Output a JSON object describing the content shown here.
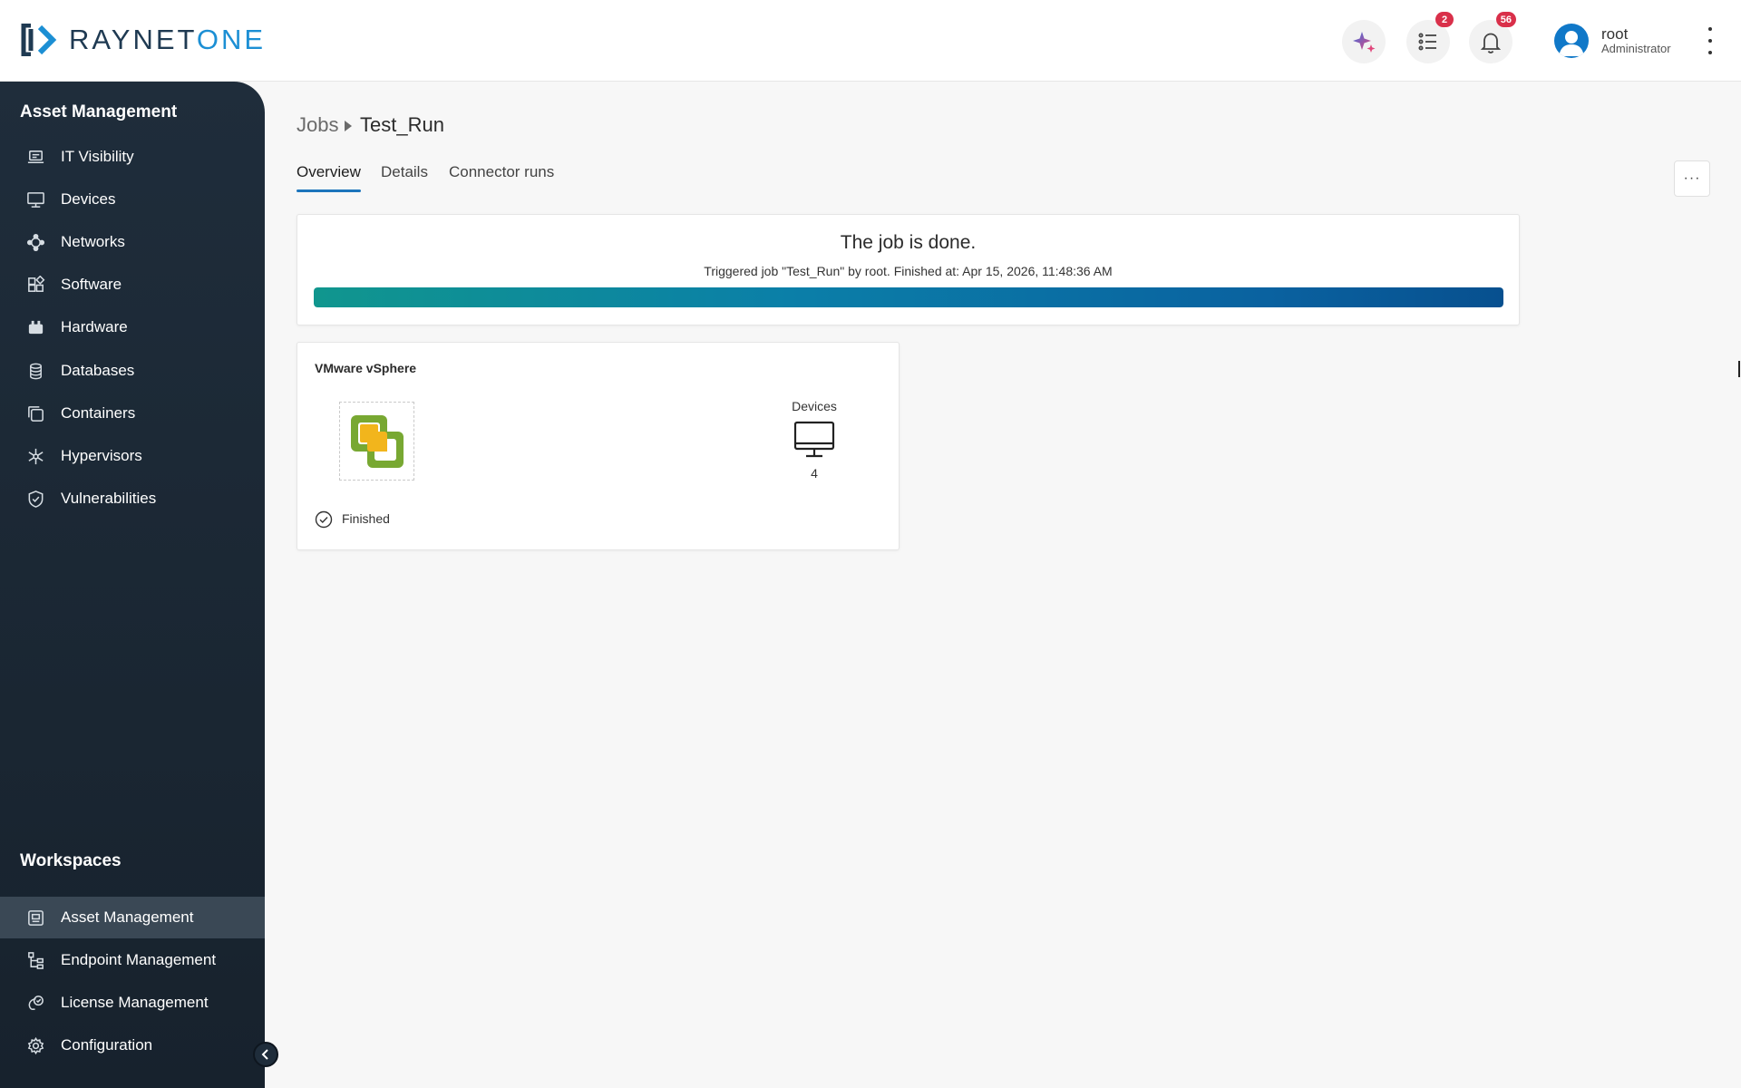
{
  "header": {
    "logo_left": "RAYNET",
    "logo_right": "ONE",
    "tasks_badge": "2",
    "notifications_badge": "56",
    "user_name": "root",
    "user_role": "Administrator"
  },
  "sidebar": {
    "section_title": "Asset Management",
    "items": [
      {
        "label": "IT Visibility",
        "icon": "laptop-icon"
      },
      {
        "label": "Devices",
        "icon": "monitor-icon"
      },
      {
        "label": "Networks",
        "icon": "network-icon"
      },
      {
        "label": "Software",
        "icon": "software-icon"
      },
      {
        "label": "Hardware",
        "icon": "hardware-icon"
      },
      {
        "label": "Databases",
        "icon": "database-icon"
      },
      {
        "label": "Containers",
        "icon": "containers-icon"
      },
      {
        "label": "Hypervisors",
        "icon": "hypervisor-icon"
      },
      {
        "label": "Vulnerabilities",
        "icon": "shield-icon"
      }
    ],
    "workspaces_title": "Workspaces",
    "workspaces": [
      {
        "label": "Asset Management",
        "icon": "asset-workspace-icon",
        "active": true
      },
      {
        "label": "Endpoint Management",
        "icon": "endpoint-workspace-icon",
        "active": false
      },
      {
        "label": "License Management",
        "icon": "license-workspace-icon",
        "active": false
      },
      {
        "label": "Configuration",
        "icon": "gear-icon",
        "active": false
      }
    ]
  },
  "breadcrumb": {
    "root": "Jobs",
    "current": "Test_Run"
  },
  "tabs": [
    {
      "label": "Overview",
      "active": true
    },
    {
      "label": "Details",
      "active": false
    },
    {
      "label": "Connector runs",
      "active": false
    }
  ],
  "more_button": "···",
  "job_status": {
    "title": "The job is done.",
    "subtitle": "Triggered job \"Test_Run\" by root. Finished at: Apr 15, 2026, 11:48:36 AM",
    "progress_percent": 100
  },
  "connector": {
    "name": "VMware vSphere",
    "metric_label": "Devices",
    "metric_value": "4",
    "status": "Finished"
  },
  "colors": {
    "sidebar_bg": "#1f2d3b",
    "accent": "#1c75bc",
    "badge": "#d9304a"
  }
}
